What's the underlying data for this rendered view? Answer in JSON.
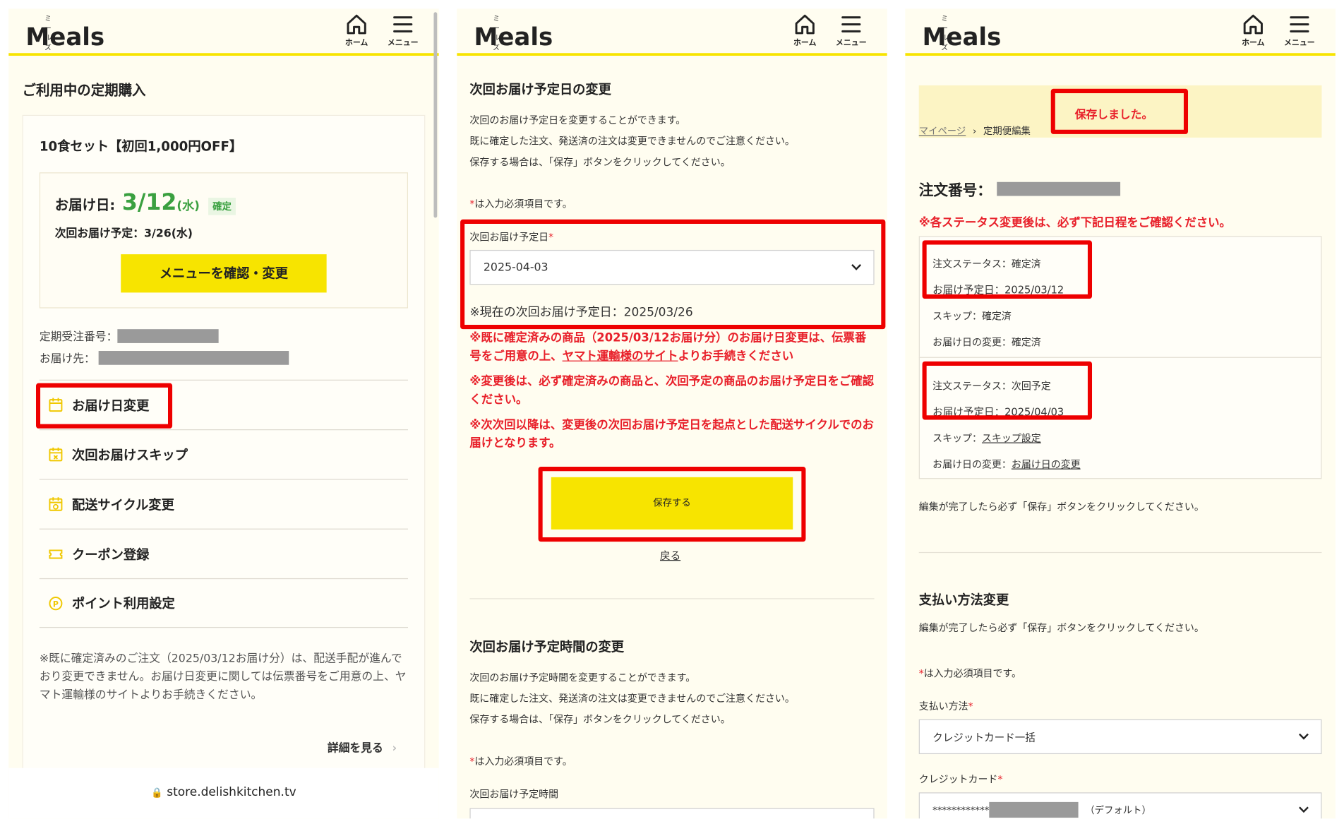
{
  "header": {
    "logo_kana": "ミールズ",
    "logo_text": "Meals",
    "home_label": "ホーム",
    "menu_label": "メニュー"
  },
  "panel1": {
    "title": "ご利用中の定期購入",
    "plan_name": "10食セット【初回1,000円OFF】",
    "delivery_label": "お届け日:",
    "delivery_date": "3/12",
    "delivery_dow": "(水)",
    "confirmed_badge": "確定",
    "next_delivery": "次回お届け予定：3/26(水)",
    "menu_button": "メニューを確認・変更",
    "order_no_label": "定期受注番号：",
    "address_label": "お届け先：",
    "menu_items": [
      {
        "label": "お届け日変更",
        "icon": "calendar-icon"
      },
      {
        "label": "次回お届けスキップ",
        "icon": "calendar-skip-icon"
      },
      {
        "label": "配送サイクル変更",
        "icon": "calendar-cycle-icon"
      },
      {
        "label": "クーポン登録",
        "icon": "coupon-icon"
      },
      {
        "label": "ポイント利用設定",
        "icon": "point-icon"
      }
    ],
    "note": "※既に確定済みのご注文（2025/03/12お届け分）は、配送手配が進んでおり変更できません。お届け日変更に関しては伝票番号をご用意の上、ヤマト運輸様のサイトよりお手続きください。",
    "details_link": "詳細を見る",
    "url": "store.delishkitchen.tv"
  },
  "panel2": {
    "section1_title": "次回お届け予定日の変更",
    "desc_lines": [
      "次回のお届け予定日を変更することができます。",
      "既に確定した注文、発送済の注文は変更できませんのでご注意ください。",
      "保存する場合は、「保存」ボタンをクリックしてください。"
    ],
    "required_note": "は入力必須項目です。",
    "date_field_label": "次回お届け予定日",
    "date_value": "2025-04-03",
    "current_date_note": "※現在の次回お届け予定日：2025/03/26",
    "warning1_pre": "※既に確定済みの商品（2025/03/12お届け分）のお届け日変更は、伝票番号をご用意の上、",
    "warning1_link": "ヤマト運輸様のサイト",
    "warning1_post": "よりお手続きください",
    "warning2": "※変更後は、必ず確定済みの商品と、次回予定の商品のお届け予定日をご確認ください。",
    "warning3": "※次次回以降は、変更後の次回お届け予定日を起点とした配送サイクルでのお届けとなります。",
    "save_button": "保存する",
    "back_link": "戻る",
    "section2_title": "次回お届け予定時間の変更",
    "desc2_lines": [
      "次回のお届け予定時間を変更することができます。",
      "既に確定した注文、発送済の注文は変更できませんのでご注意ください。",
      "保存する場合は、「保存」ボタンをクリックしてください。"
    ],
    "time_field_label": "次回お届け予定時間"
  },
  "panel3": {
    "saved_message": "保存しました。",
    "breadcrumb_home": "マイページ",
    "breadcrumb_current": "定期便編集",
    "order_no_label": "注文番号：",
    "status_warning": "※各ステータス変更後は、必ず下記日程をご確認ください。",
    "order1": {
      "status": "注文ステータス：確定済",
      "date": "お届け予定日：2025/03/12",
      "skip": "スキップ：確定済",
      "change": "お届け日の変更：確定済"
    },
    "order2": {
      "status": "注文ステータス：次回予定",
      "date": "お届け予定日：2025/04/03",
      "skip_label": "スキップ：",
      "skip_link": "スキップ設定",
      "change_label": "お届け日の変更：",
      "change_link": "お届け日の変更"
    },
    "save_reminder": "編集が完了したら必ず「保存」ボタンをクリックしてください。",
    "payment_title": "支払い方法変更",
    "payment_reminder": "編集が完了したら必ず「保存」ボタンをクリックしてください。",
    "required_note": "は入力必須項目です。",
    "payment_method_label": "支払い方法",
    "payment_method_value": "クレジットカード一括",
    "card_label": "クレジットカード",
    "card_mask": "************",
    "card_default": "（デフォルト）"
  },
  "colors": {
    "brand_yellow": "#f7e400",
    "highlight_red": "#ee0000",
    "warning_red": "#e8202a",
    "confirmed_green": "#3aa040"
  }
}
